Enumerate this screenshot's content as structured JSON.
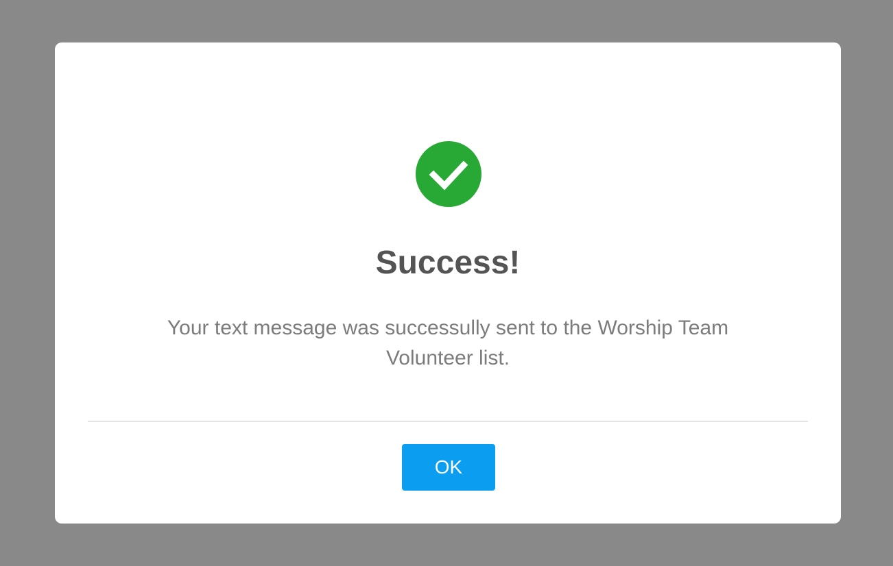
{
  "dialog": {
    "icon": "check-circle-icon",
    "icon_color": "#28a834",
    "title": "Success!",
    "message": "Your text message was successully sent to the Worship Team Volunteer list.",
    "ok_label": "OK",
    "button_color": "#0b9df0",
    "overlay_color": "#898989"
  }
}
